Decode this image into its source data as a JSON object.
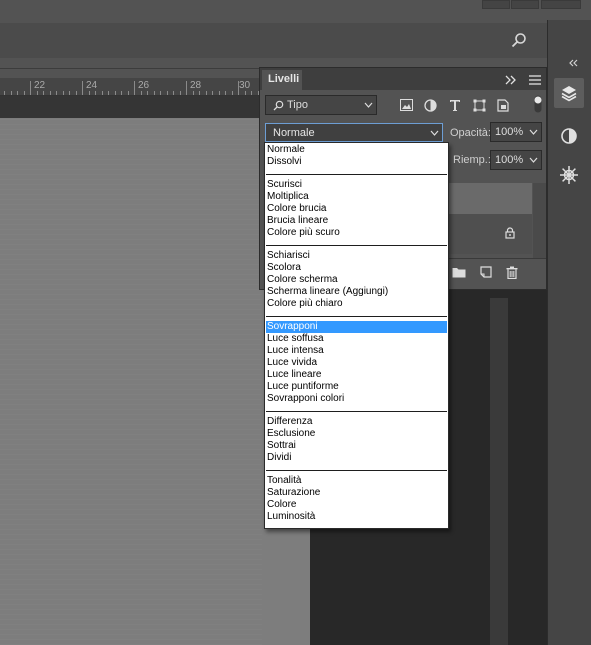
{
  "ruler": {
    "labels": [
      "22",
      "24",
      "26",
      "28",
      "30"
    ]
  },
  "layers_panel": {
    "tab_label": "Livelli",
    "filter_value": "Tipo",
    "blend_mode_value": "Normale",
    "opacity_label": "Opacità:",
    "opacity_value": "100%",
    "fill_label": "Riemp.:",
    "fill_value": "100%"
  },
  "blend_modes": {
    "groups": [
      [
        "Normale",
        "Dissolvi"
      ],
      [
        "Scurisci",
        "Moltiplica",
        "Colore brucia",
        "Brucia lineare",
        "Colore più scuro"
      ],
      [
        "Schiarisci",
        "Scolora",
        "Colore scherma",
        "Scherma lineare (Aggiungi)",
        "Colore più chiaro"
      ],
      [
        "Sovrapponi",
        "Luce soffusa",
        "Luce intensa",
        "Luce vivida",
        "Luce lineare",
        "Luce puntiforme",
        "Sovrapponi colori"
      ],
      [
        "Differenza",
        "Esclusione",
        "Sottrai",
        "Dividi"
      ],
      [
        "Tonalità",
        "Saturazione",
        "Colore",
        "Luminosità"
      ]
    ],
    "selected": "Sovrapponi"
  },
  "colors": {
    "highlight": "#3399ff",
    "canvas": "#7d7d7d",
    "panel": "#535353"
  }
}
